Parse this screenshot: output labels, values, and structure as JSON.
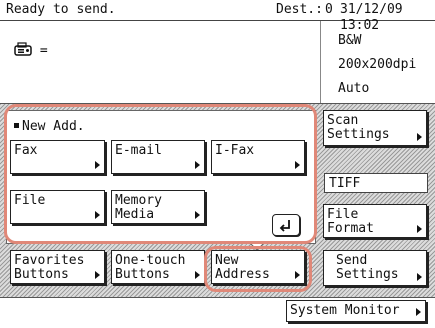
{
  "status": {
    "message": "Ready to send.",
    "dest_label": "Dest.:",
    "dest_count": "0",
    "datetime": "31/12/09 13:02"
  },
  "header": {
    "fax_icon": "fax-machine-icon",
    "fax_equals": "=",
    "color_mode": "B&W",
    "resolution": "200x200dpi",
    "density": "Auto"
  },
  "panel": {
    "title": "New Add."
  },
  "address_buttons": {
    "fax": "Fax",
    "email": "E-mail",
    "ifax": "I-Fax",
    "file": "File",
    "memory_media": "Memory\nMedia"
  },
  "tabs": {
    "favorites": "Favorites\nButtons",
    "one_touch": "One-touch\nButtons",
    "new_address": "New\nAddress"
  },
  "side": {
    "scan_settings": "Scan\nSettings",
    "file_format_value": "TIFF",
    "file_format": "File\nFormat",
    "send_settings": "Send\nSettings"
  },
  "footer": {
    "system_monitor": "System Monitor"
  },
  "colors": {
    "highlight": "#e08878"
  }
}
